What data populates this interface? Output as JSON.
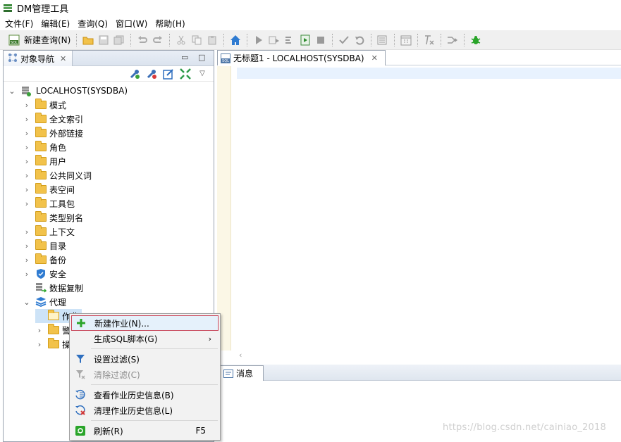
{
  "window": {
    "title": "DM管理工具"
  },
  "menubar": [
    {
      "label": "文件(F)"
    },
    {
      "label": "编辑(E)"
    },
    {
      "label": "查询(Q)"
    },
    {
      "label": "窗口(W)"
    },
    {
      "label": "帮助(H)"
    }
  ],
  "toolbar": {
    "new_query_label": "新建查询(N)"
  },
  "navigator": {
    "tab_label": "对象导航",
    "root": "LOCALHOST(SYSDBA)",
    "nodes": [
      "模式",
      "全文索引",
      "外部链接",
      "角色",
      "用户",
      "公共同义词",
      "表空间",
      "工具包",
      "类型别名",
      "上下文",
      "目录",
      "备份",
      "安全",
      "数据复制",
      "代理"
    ],
    "agent_children": [
      "作业",
      "警",
      "操"
    ]
  },
  "editor": {
    "tab_label": "无标题1 - LOCALHOST(SYSDBA)"
  },
  "messages": {
    "tab_label": "消息"
  },
  "context_menu": {
    "items": [
      {
        "label": "新建作业(N)...",
        "icon": "plus-icon"
      },
      {
        "label": "生成SQL脚本(G)",
        "arrow": "›"
      },
      {
        "label": "设置过滤(S)",
        "icon": "filter-icon"
      },
      {
        "label": "清除过滤(C)",
        "icon": "clear-filter-icon"
      },
      {
        "label": "查看作业历史信息(B)",
        "icon": "history-icon"
      },
      {
        "label": "清理作业历史信息(L)",
        "icon": "clear-history-icon"
      },
      {
        "label": "刷新(R)",
        "icon": "refresh-icon",
        "accel": "F5"
      }
    ]
  },
  "watermark": "https://blog.csdn.net/cainiao_2018",
  "colors": {
    "accent": "#3a7bd5",
    "folder": "#f2c24a",
    "highlight_border": "#c8475b"
  }
}
